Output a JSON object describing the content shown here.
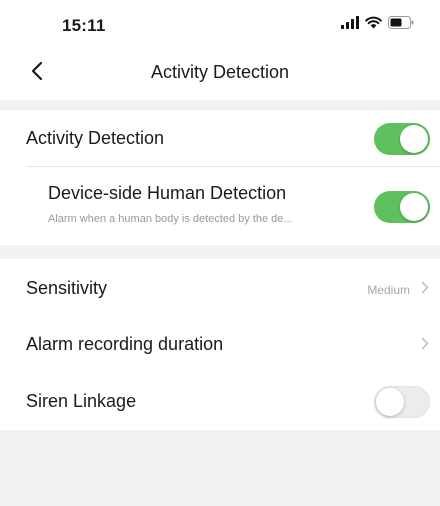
{
  "status_bar": {
    "time": "15:11",
    "icons": [
      "signal-icon",
      "wifi-icon",
      "battery-icon"
    ]
  },
  "nav": {
    "back_icon": "chevron-left-icon",
    "title": "Activity Detection"
  },
  "settings": {
    "activity_detection": {
      "label": "Activity Detection",
      "enabled": true
    },
    "human_detection": {
      "label": "Device-side Human Detection",
      "description": "Alarm when a human body is detected by the de...",
      "enabled": true
    },
    "sensitivity": {
      "label": "Sensitivity",
      "value": "Medium"
    },
    "alarm_recording_duration": {
      "label": "Alarm recording duration",
      "value": ""
    },
    "siren_linkage": {
      "label": "Siren Linkage",
      "enabled": false
    }
  },
  "colors": {
    "toggle_on": "#5ec05e",
    "toggle_off": "#ececec",
    "section_gap": "#f2f2f2",
    "secondary_text": "#a8a8a8"
  }
}
